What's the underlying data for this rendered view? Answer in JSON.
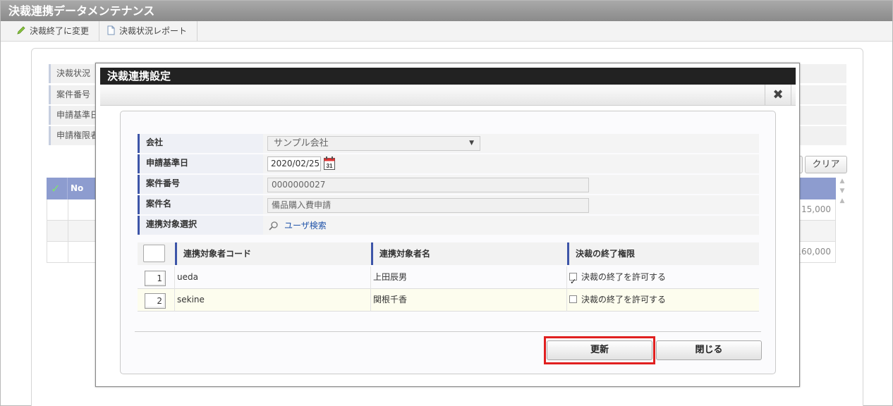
{
  "app": {
    "title": "決裁連携データメンテナンス"
  },
  "toolbar": {
    "change_label": "決裁終了に変更",
    "report_label": "決裁状況レポート"
  },
  "background": {
    "labels": [
      "決裁状況",
      "案件番号",
      "申請基準日",
      "申請権限者"
    ],
    "clear_label": "クリア",
    "grid_no_header": "No",
    "amounts": [
      "15,000",
      "",
      "160,000"
    ]
  },
  "modal": {
    "title": "決裁連携設定",
    "form": {
      "company_label": "会社",
      "company_value": "サンプル会社",
      "date_label": "申請基準日",
      "date_value": "2020/02/25",
      "calendar_day": "31",
      "case_no_label": "案件番号",
      "case_no_value": "0000000027",
      "case_name_label": "案件名",
      "case_name_value": "備品購入費申請",
      "target_label": "連携対象選択",
      "user_search": "ユーザ検索"
    },
    "grid": {
      "headers": [
        "連携対象者コード",
        "連携対象者名",
        "決裁の終了権限"
      ],
      "rows": [
        {
          "no": "1",
          "code": "ueda",
          "name": "上田辰男",
          "permission_label": "決裁の終了を許可する",
          "checked": true
        },
        {
          "no": "2",
          "code": "sekine",
          "name": "関根千香",
          "permission_label": "決裁の終了を許可する",
          "checked": false
        }
      ]
    },
    "buttons": {
      "update": "更新",
      "close": "閉じる"
    },
    "colors": {
      "highlight": "#e02020",
      "accent": "#3d55a8"
    }
  }
}
